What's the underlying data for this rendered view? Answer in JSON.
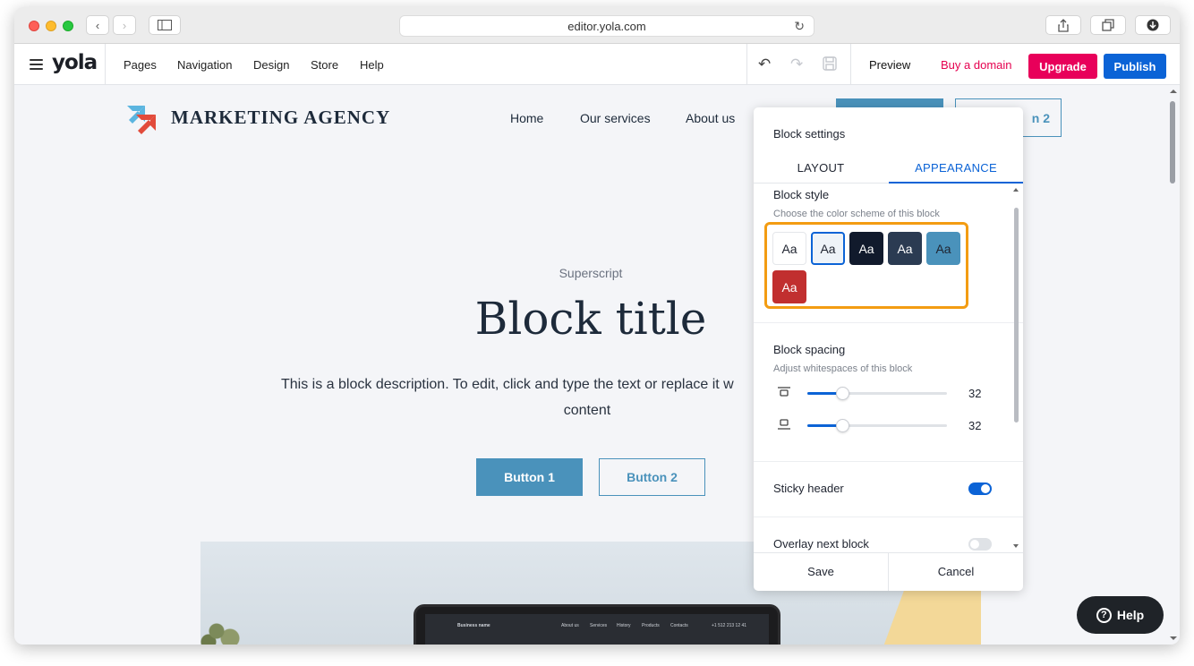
{
  "browser": {
    "url": "editor.yola.com"
  },
  "toolbar": {
    "logo": "yola",
    "nav": [
      "Pages",
      "Navigation",
      "Design",
      "Store",
      "Help"
    ],
    "preview_label": "Preview",
    "buy_domain_label": "Buy a domain",
    "upgrade_label": "Upgrade",
    "publish_label": "Publish"
  },
  "site": {
    "brand": "MARKETING AGENCY",
    "nav": [
      "Home",
      "Our services",
      "About us"
    ],
    "header_button2_partial": "n 2",
    "superscript": "Superscript",
    "title": "Block title",
    "description": "This is a block description. To edit, click and type the text or replace it w",
    "description_line2": "content",
    "button1": "Button 1",
    "button2": "Button 2",
    "laptop_nav": [
      "Business name",
      "About us",
      "Services",
      "History",
      "Products",
      "Contacts",
      "+1 512 213 12 41"
    ]
  },
  "panel": {
    "title": "Block settings",
    "tabs": [
      "LAYOUT",
      "APPEARANCE"
    ],
    "active_tab": "APPEARANCE",
    "block_style": {
      "title": "Block style",
      "subtitle": "Choose the color scheme of this block",
      "swatch_label": "Aa",
      "selected_index": 1,
      "swatches": [
        {
          "bg": "#ffffff",
          "fg": "#1f2430"
        },
        {
          "bg": "#eef3f8",
          "fg": "#1f2430"
        },
        {
          "bg": "#111a2c",
          "fg": "#ffffff"
        },
        {
          "bg": "#2b3b52",
          "fg": "#ffffff"
        },
        {
          "bg": "#4a92bb",
          "fg": "#1f2430"
        },
        {
          "bg": "#c12f2f",
          "fg": "#ffffff"
        }
      ]
    },
    "block_spacing": {
      "title": "Block spacing",
      "subtitle": "Adjust whitespaces of this block",
      "top_value": "32",
      "bottom_value": "32",
      "top_fraction": 0.25,
      "bottom_fraction": 0.25
    },
    "sticky_header": {
      "label": "Sticky header",
      "on": true
    },
    "overlay_next_block": {
      "label": "Overlay next block",
      "on": false
    },
    "save_label": "Save",
    "cancel_label": "Cancel"
  },
  "help_label": "Help",
  "colors": {
    "accent": "#0b63d6",
    "upgrade": "#e8005a",
    "site_accent": "#4a92bb",
    "highlight": "#f39c12"
  }
}
